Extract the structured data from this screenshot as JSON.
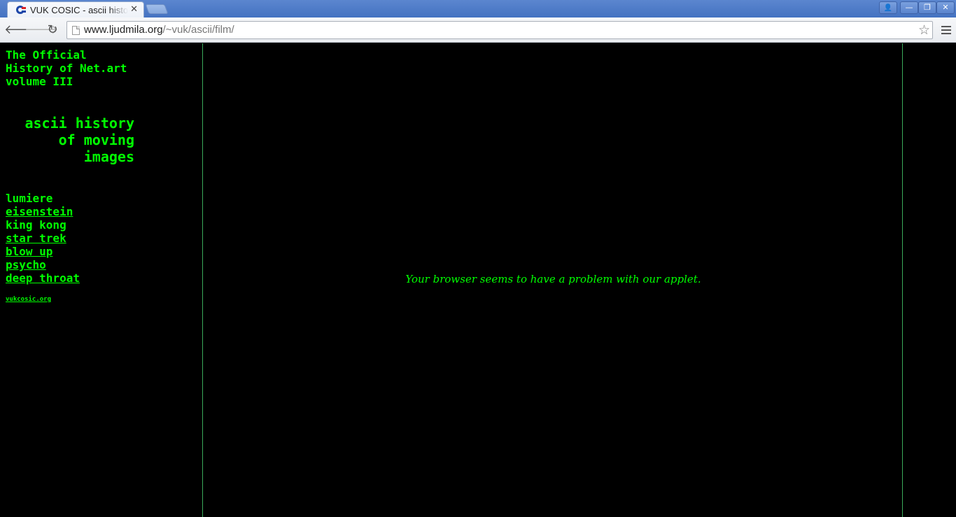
{
  "browser": {
    "tab_title": "VUK COSIC - ascii history of moving images",
    "tab_close": "✕",
    "url_host": "www.ljudmila.org",
    "url_path": "/~vuk/ascii/film/",
    "back_glyph": "🡐",
    "forward_glyph": "🡒",
    "reload_glyph": "↻",
    "star_glyph": "☆",
    "window_controls": {
      "user": "👤",
      "minimize": "—",
      "restore": "❐",
      "close": "✕"
    }
  },
  "sidebar": {
    "header_lines": [
      "The Official",
      "History of Net.art",
      "volume III"
    ],
    "title_lines": [
      "ascii history",
      "of moving",
      "images"
    ],
    "films": [
      {
        "label": "lumiere",
        "link": false
      },
      {
        "label": "eisenstein",
        "link": true
      },
      {
        "label": "king kong",
        "link": false
      },
      {
        "label": "star trek",
        "link": true
      },
      {
        "label": "blow up",
        "link": true
      },
      {
        "label": "psycho",
        "link": true
      },
      {
        "label": "deep throat",
        "link": true
      }
    ],
    "credit": "vukcosic.org"
  },
  "main": {
    "applet_message": "Your browser seems to have a problem with our applet."
  },
  "colors": {
    "text_green": "#00ff00",
    "frame_border": "#3aaa5a",
    "background": "#000000"
  }
}
